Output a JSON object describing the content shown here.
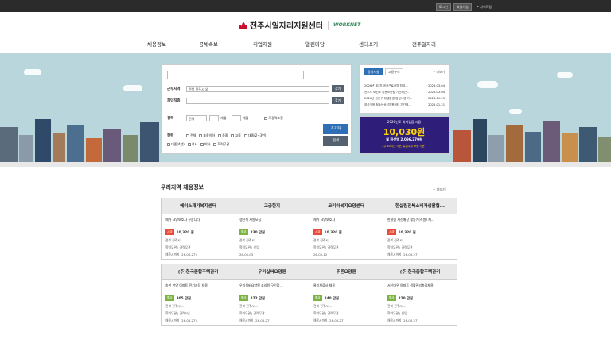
{
  "topbar": {
    "login": "로그인",
    "register": "회원가입",
    "sitemap": "• 사이트맵"
  },
  "logo": {
    "title": "전주시일자리지원센터",
    "partner": "WORKNET"
  },
  "nav": [
    "채용정보",
    "공채속보",
    "취업지원",
    "열린마당",
    "센터소개",
    "전주일자리"
  ],
  "search": {
    "region_label": "근무지역",
    "region_value": "전북 전주시 외",
    "find": "찾기",
    "job_label": "희망직종",
    "career_label": "경력",
    "career_value": "전체",
    "months": "개월 ~",
    "months2": "개월",
    "no_career": "무경력포함",
    "edu_label": "학력",
    "edu_opts": [
      "전체",
      "초졸이하",
      "중졸",
      "고졸",
      "대졸(2~3년)",
      "대졸(4년)",
      "석사",
      "박사",
      "학력무관"
    ],
    "detail_btn": "초기화",
    "search_btn": "검색"
  },
  "notice": {
    "tabs": [
      "공지사항",
      "고용뉴스"
    ],
    "more": "+ 더보기",
    "items": [
      {
        "title": "2026년 제1차 공공근로사업 참여...",
        "date": "2026-03-04"
      },
      {
        "title": "전주시 보건소 방문보건팀 기간제근...",
        "date": "2026-03-04"
      },
      {
        "title": "2026년 완산구 위생환경 점검사업 기...",
        "date": "2026-01-23"
      },
      {
        "title": "여성구청 청소년상담지원센터 기간제...",
        "date": "2026-01-21"
      }
    ]
  },
  "wage": {
    "year_text": "2026년도 최저임금 시급",
    "hourly": "10,030원",
    "monthly": "월 환산액 2,096,270원",
    "note": "- 주 40시간 기준, 유급주휴 포함 기준 -"
  },
  "section": {
    "title": "우리지역 채용정보",
    "more": "+ 더보기"
  },
  "colors": {
    "badge_month": "#e74c3c",
    "badge_hour": "#7cb342",
    "btn_primary": "#2f6fb5",
    "btn_dark": "#546270"
  },
  "jobs": [
    {
      "company": "에이스재가복지센터",
      "desc": "재가 요양보호사 구합니다.",
      "pay_type": "시급",
      "pay": "10,320 원",
      "loc": "전북 전주시 ...",
      "cond": "학력무관 | 경력무관",
      "deadline": "채용시까지 (26-06-27)"
    },
    {
      "company": "고궁한지",
      "desc": "생산직 사원모집",
      "pay_type": "월급",
      "pay": "230 만원",
      "loc": "전북 전주시 ...",
      "cond": "학력무관 | 신입",
      "deadline": "26-05-05"
    },
    {
      "company": "코리아복지요양센터",
      "desc": "재가 요양보호사",
      "pay_type": "시급",
      "pay": "10,320 원",
      "loc": "전북 전주시 ...",
      "cond": "학력무관 | 경력무관",
      "deadline": "26-05-12"
    },
    {
      "company": "한살림전북소비자생활협...",
      "desc": "한살림 서신매장 활동가(직원) 채...",
      "pay_type": "시급",
      "pay": "10,320 원",
      "loc": "전북 전주시 ...",
      "cond": "학력무관 | 경력무관",
      "deadline": "채용시까지 (26-06-27)"
    },
    {
      "company": "(주)한국종합주택관리",
      "desc": "송천 한양 아파트 전기과장 채용",
      "pay_type": "월급",
      "pay": "305 만원",
      "loc": "전북 전주시 ...",
      "cond": "학력무관 | 경력5년",
      "deadline": "채용시까지 (26-06-27)"
    },
    {
      "company": "우리실버요양원",
      "desc": "우리실버요양원 조리원 구인합...",
      "pay_type": "월급",
      "pay": "272 만원",
      "loc": "전북 전주시 ...",
      "cond": "학력무관 | 경력무관",
      "deadline": "채용시까지 (26-06-27)"
    },
    {
      "company": "푸른요양원",
      "desc": "물리치료사 채용",
      "pay_type": "월급",
      "pay": "240 만원",
      "loc": "전북 전주시 ...",
      "cond": "학력무관 | 경력무관",
      "deadline": "채용시까지 (26-06-27)"
    },
    {
      "company": "(주)한국종합주택관리",
      "desc": "서신대우 아파트 생활관리총괄채용",
      "pay_type": "월급",
      "pay": "220 만원",
      "loc": "전북 전주시 ...",
      "cond": "학력무관 | 신입",
      "deadline": "채용시까지 (26-06-27)"
    }
  ]
}
